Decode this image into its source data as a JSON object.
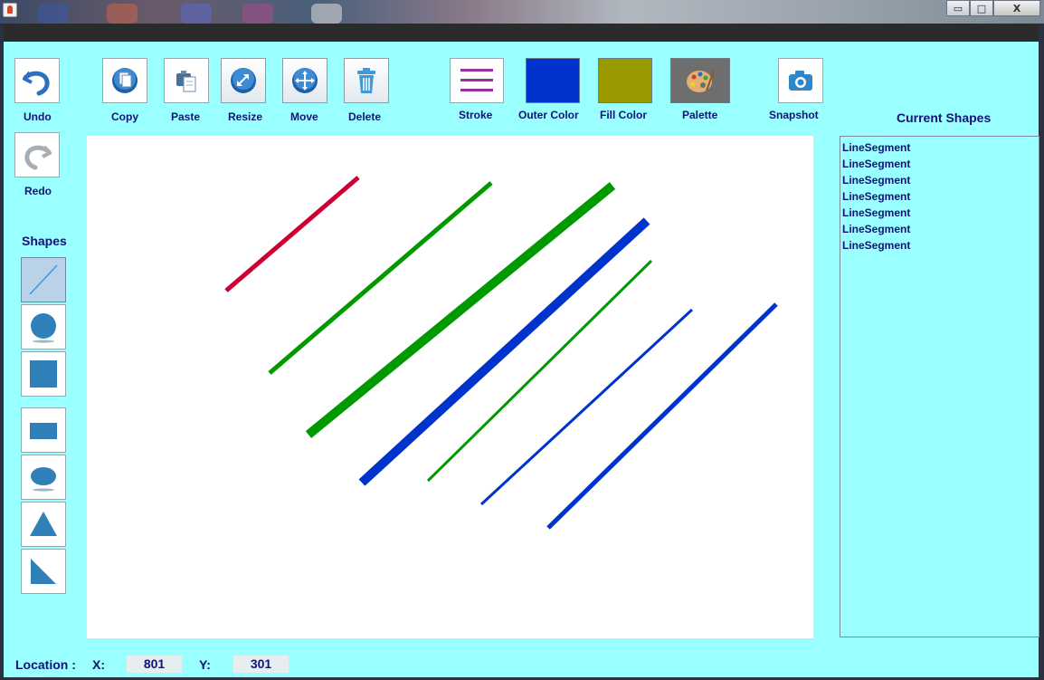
{
  "window": {
    "controls": {
      "minimize": "▭",
      "maximize": "□",
      "close": "X"
    }
  },
  "toolbar": {
    "undo": "Undo",
    "redo": "Redo",
    "copy": "Copy",
    "paste": "Paste",
    "resize": "Resize",
    "move": "Move",
    "delete": "Delete",
    "stroke": "Stroke",
    "outer_color": "Outer Color",
    "fill_color": "Fill Color",
    "palette": "Palette",
    "snapshot": "Snapshot"
  },
  "colors": {
    "background": "#99ffff",
    "outer_color": "#0033cc",
    "fill_color": "#999900",
    "stroke_icon": "#9b2fa6",
    "label_text": "#12127a"
  },
  "shapes_panel": {
    "title": "Shapes",
    "tools": [
      {
        "icon": "line-icon",
        "selected": true
      },
      {
        "icon": "circle-icon",
        "selected": false
      },
      {
        "icon": "square-icon",
        "selected": false
      },
      {
        "icon": "rectangle-icon",
        "selected": false
      },
      {
        "icon": "ellipse-icon",
        "selected": false
      },
      {
        "icon": "triangle-icon",
        "selected": false
      },
      {
        "icon": "right-triangle-icon",
        "selected": false
      }
    ]
  },
  "current_shapes": {
    "title": "Current Shapes",
    "items": [
      "LineSegment",
      "LineSegment",
      "LineSegment",
      "LineSegment",
      "LineSegment",
      "LineSegment",
      "LineSegment"
    ]
  },
  "status": {
    "location_label": "Location :",
    "x_label": "X:",
    "x_value": "801",
    "y_label": "Y:",
    "y_value": "301"
  }
}
